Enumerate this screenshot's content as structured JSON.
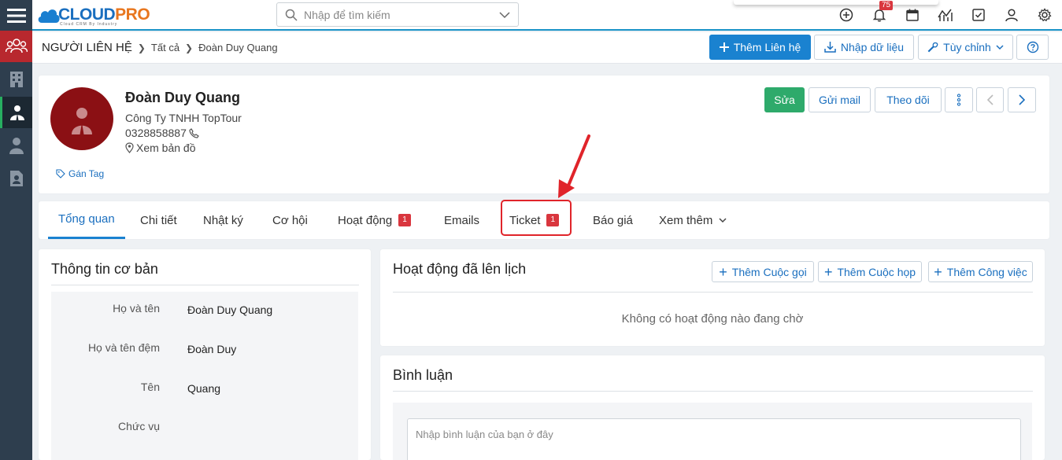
{
  "topbar": {
    "logo_part1": "CLOUD",
    "logo_part2": "PRO",
    "logo_sub": "Cloud CRM By Industry",
    "search_placeholder": "Nhập để tìm kiếm",
    "notification_count": "75",
    "icons": [
      "plus-circle-icon",
      "bell-icon",
      "calendar-icon",
      "chart-icon",
      "checkbox-icon",
      "user-icon",
      "gear-icon"
    ]
  },
  "sidebar": {
    "items": [
      "contacts-group-icon",
      "building-icon",
      "contact-person-icon",
      "person-icon",
      "document-person-icon"
    ]
  },
  "header": {
    "breadcrumb_root": "NGƯỜI LIÊN HỆ",
    "breadcrumb_all": "Tất cả",
    "breadcrumb_current": "Đoàn Duy Quang",
    "add_button": "Thêm Liên hệ",
    "import_button": "Nhập dữ liệu",
    "custom_button": "Tùy chỉnh"
  },
  "profile": {
    "name": "Đoàn Duy Quang",
    "company": "Công Ty TNHH TopTour",
    "phone": "0328858887",
    "map_link": "Xem bản đồ",
    "tag_link": "Gán Tag",
    "edit_button": "Sửa",
    "mail_button": "Gửi mail",
    "follow_button": "Theo dõi"
  },
  "tabs": [
    {
      "label": "Tổng quan",
      "badge": ""
    },
    {
      "label": "Chi tiết",
      "badge": ""
    },
    {
      "label": "Nhật ký",
      "badge": ""
    },
    {
      "label": "Cơ hội",
      "badge": ""
    },
    {
      "label": "Hoạt động",
      "badge": "1"
    },
    {
      "label": "Emails",
      "badge": ""
    },
    {
      "label": "Ticket",
      "badge": "1"
    },
    {
      "label": "Báo giá",
      "badge": ""
    },
    {
      "label": "Xem thêm",
      "badge": ""
    }
  ],
  "basic_info": {
    "title": "Thông tin cơ bản",
    "fields": [
      {
        "label": "Họ và tên",
        "value": "Đoàn Duy Quang"
      },
      {
        "label": "Họ và tên đệm",
        "value": "Đoàn Duy"
      },
      {
        "label": "Tên",
        "value": "Quang"
      },
      {
        "label": "Chức vụ",
        "value": ""
      }
    ]
  },
  "activities": {
    "title": "Hoạt động đã lên lịch",
    "add_call": "Thêm Cuộc gọi",
    "add_meeting": "Thêm Cuộc họp",
    "add_task": "Thêm Công việc",
    "empty_message": "Không có hoạt động nào đang chờ"
  },
  "comments": {
    "title": "Bình luận",
    "placeholder": "Nhập bình luận của bạn ở đây"
  },
  "colors": {
    "accent": "#1a82d0",
    "sidebar": "#2e3e4e",
    "edit_green": "#2eaa6b",
    "badge_red": "#d9363e",
    "annotation_red": "#e0242a"
  }
}
